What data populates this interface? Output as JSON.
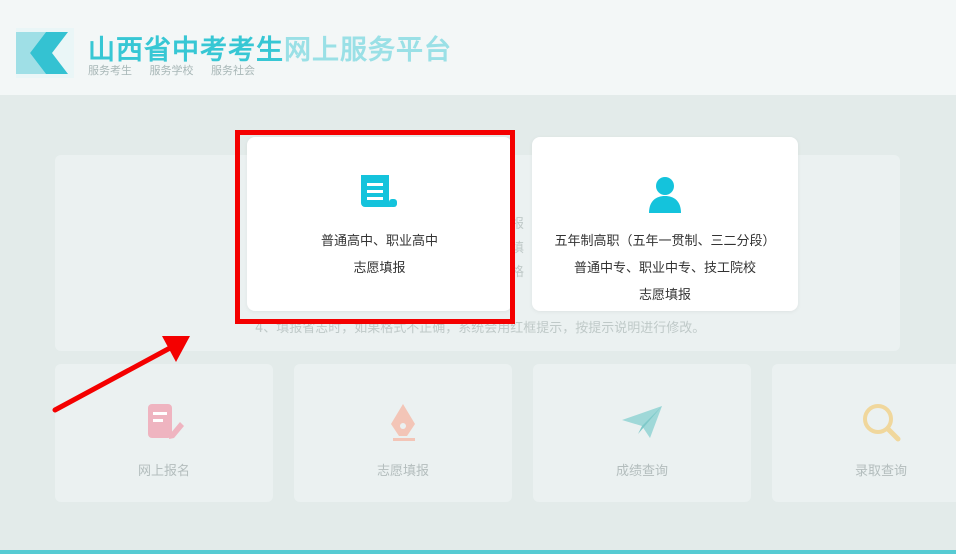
{
  "header": {
    "title_part1": "山西省中考考生",
    "title_part2": "网上服务平台",
    "subtitles": [
      "服务考生",
      "服务学校",
      "服务社会"
    ]
  },
  "notice": {
    "fragments": [
      "报",
      "填",
      "格",
      "4、填报省志时，如果格式不正确，系统会用红框提示，按提示说明进行修改。"
    ]
  },
  "dialog": {
    "options": [
      {
        "line1": "普通高中、职业高中",
        "line2": "志愿填报",
        "icon": "scroll-doc-icon"
      },
      {
        "line1": "五年制高职（五年一贯制、三二分段）",
        "line2": "普通中专、职业中专、技工院校",
        "line3": "志愿填报",
        "icon": "user-icon"
      }
    ]
  },
  "features": [
    {
      "label": "网上报名",
      "icon": "edit-form-icon"
    },
    {
      "label": "志愿填报",
      "icon": "pen-nib-icon"
    },
    {
      "label": "成绩查询",
      "icon": "paper-plane-icon"
    },
    {
      "label": "录取查询",
      "icon": "magnifier-icon"
    }
  ],
  "colors": {
    "brand_primary": "#37c7d4",
    "brand_light": "#9ae0e6",
    "highlight_red": "#f40000",
    "icon_cyan": "#14c3dc"
  }
}
